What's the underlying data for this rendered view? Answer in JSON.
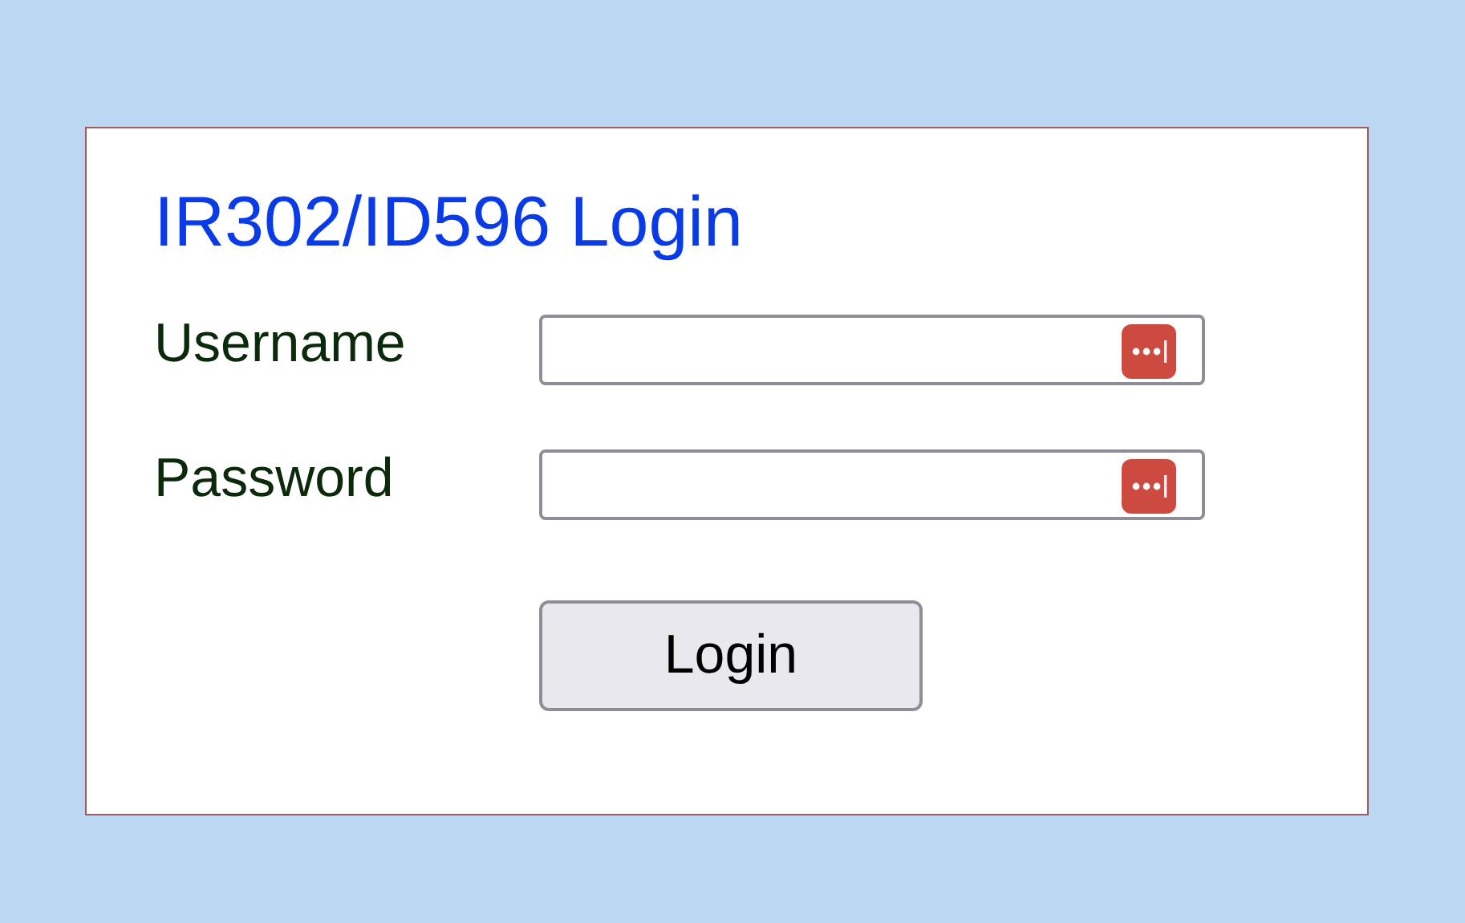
{
  "title": "IR302/ID596 Login",
  "fields": [
    {
      "label": "Username"
    },
    {
      "label": "Password"
    }
  ],
  "button": "Login"
}
